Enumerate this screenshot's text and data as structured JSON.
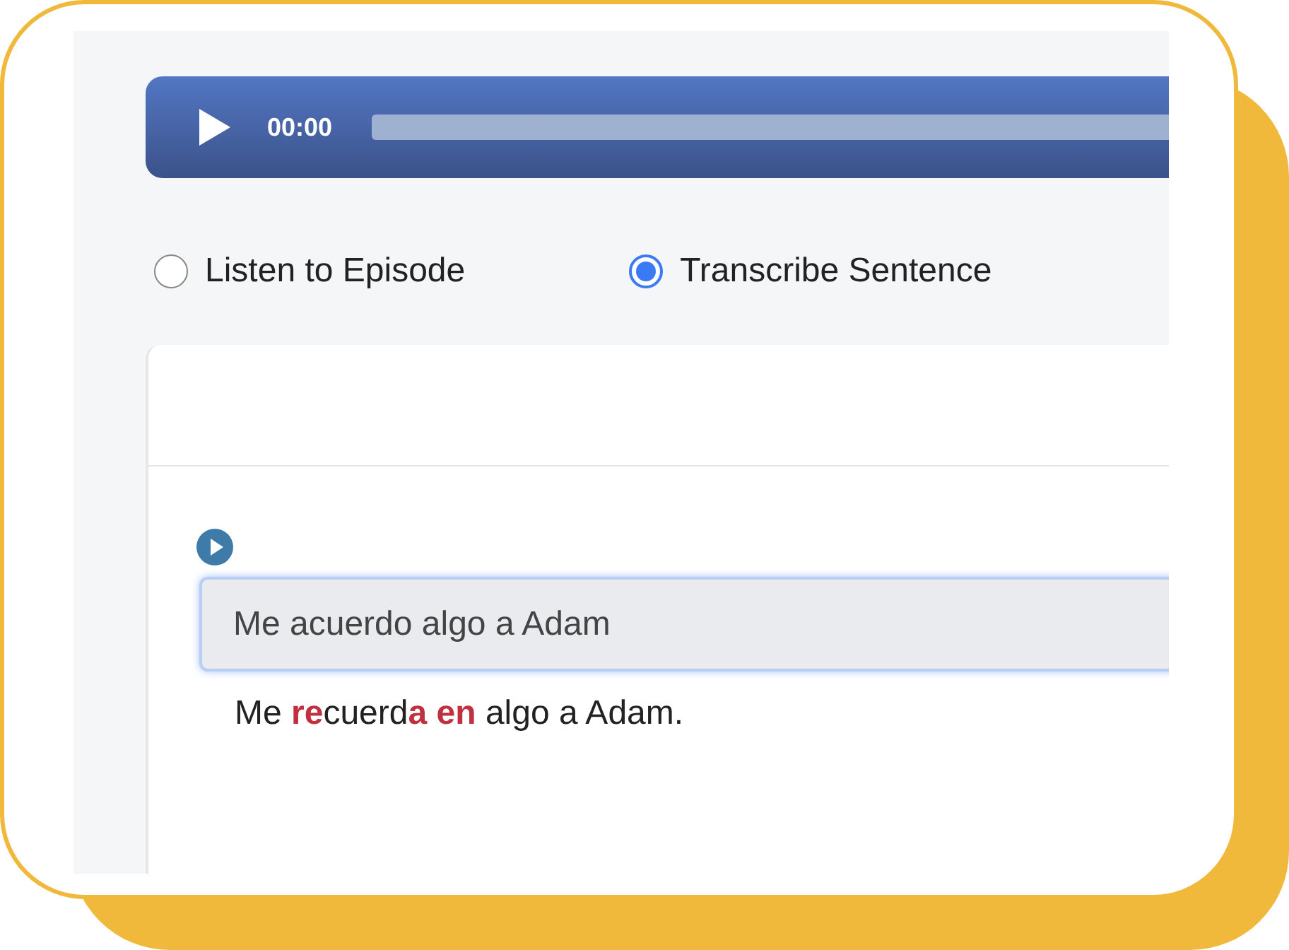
{
  "audio_player": {
    "time": "00:00"
  },
  "modes": [
    {
      "label": "Listen to Episode",
      "selected": false
    },
    {
      "label": "Transcribe Sentence",
      "selected": true
    }
  ],
  "transcription": {
    "answer": "Me acuerdo algo a Adam",
    "correction": "Me **re**cuerd**a en** algo a Adam."
  }
}
